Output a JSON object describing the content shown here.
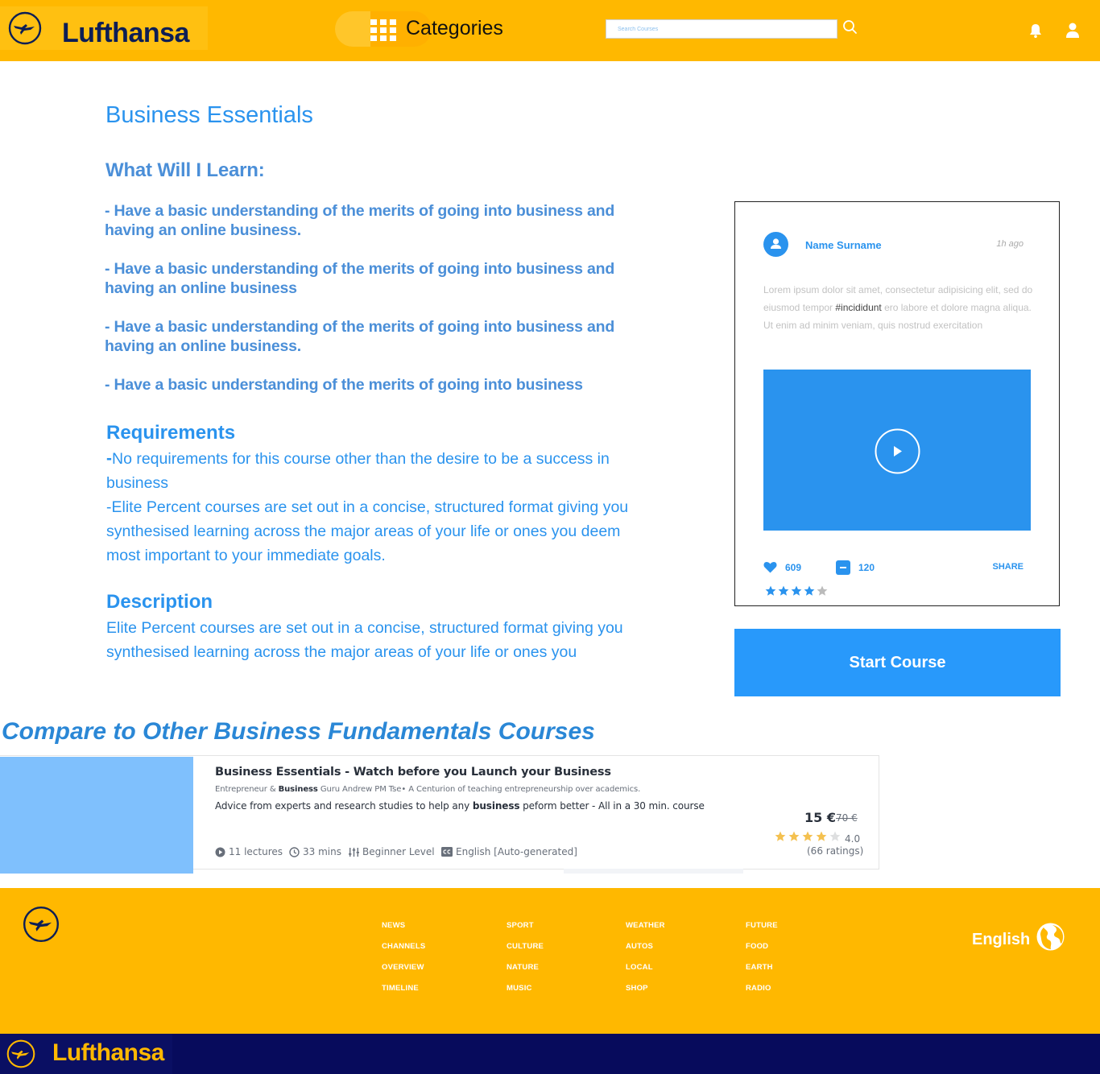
{
  "header": {
    "brand": "Lufthansa",
    "categories_label": "Categories",
    "search_placeholder": "Search Courses"
  },
  "course": {
    "title": "Business Essentials",
    "learn_heading": "What Will I  Learn:",
    "learn_items": [
      "- Have a basic understanding of the merits of going into business and having an online business.",
      "-  Have a basic understanding of the merits of going into business and having an online business",
      "- Have a basic understanding of the merits of going into business and having an online business.",
      "-  Have a basic understanding of the merits of going into business"
    ],
    "requirements_heading": "Requirements",
    "requirements_line1_dash": "-",
    "requirements_line1": "No requirements for this course other than the desire to be a success in business",
    "requirements_line2": "-Elite Percent courses are set out in a concise, structured format giving you synthesised learning across the major areas of your life or ones you deem most important to your immediate goals.",
    "description_heading": "Description",
    "description_text": "Elite Percent courses are set out in a concise, structured format giving you synthesised learning across the major areas of your life or ones you"
  },
  "post": {
    "author": "Name Surname",
    "time": "1h ago",
    "text_before": "Lorem ipsum dolor sit amet, consectetur adipisicing elit, sed do eiusmod tempor ",
    "hashtag": "#incididunt",
    "text_after": " ero labore et dolore magna aliqua. Ut enim ad minim veniam, quis nostrud exercitation",
    "likes": "609",
    "comments": "120",
    "share_label": "SHARE",
    "rating_filled": 4,
    "rating_total": 5
  },
  "start_button_label": "Start Course",
  "compare": {
    "heading": "Compare to Other Business Fundamentals Courses",
    "card": {
      "title": "Business Essentials - Watch before you Launch your Business",
      "author_prefix": "Entrepreneur & ",
      "author_bold": "Business",
      "author_suffix": " Guru Andrew PM Tse• A Centurion of teaching entrepreneurship over academics.",
      "desc_prefix": "Advice from experts and research studies to help any ",
      "desc_bold": "business",
      "desc_suffix": " peform better - All in a 30 min. course",
      "price": "15 €",
      "old_price": "70 €",
      "rating_value": "4.0",
      "rating_count": "(66 ratings)",
      "rating_filled": 4,
      "lectures": "11 lectures",
      "duration": "33 mins",
      "level": "Beginner Level",
      "language": "English [Auto-generated]"
    }
  },
  "footer": {
    "columns": [
      [
        "NEWS",
        "CHANNELS",
        "OVERVIEW",
        "TIMELINE"
      ],
      [
        "SPORT",
        "CULTURE",
        "NATURE",
        "MUSIC"
      ],
      [
        "WEATHER",
        "AUTOS",
        "LOCAL",
        "SHOP"
      ],
      [
        "FUTURE",
        "FOOD",
        "EARTH",
        "RADIO"
      ]
    ],
    "language": "English"
  },
  "bottom_bar": {
    "brand": "Lufthansa"
  },
  "colors": {
    "brand_yellow": "#ffb800",
    "brand_navy": "#0d1e55",
    "accent_blue": "#2a93ee",
    "button_blue": "#2899fb",
    "star_gold": "#f4c150"
  }
}
